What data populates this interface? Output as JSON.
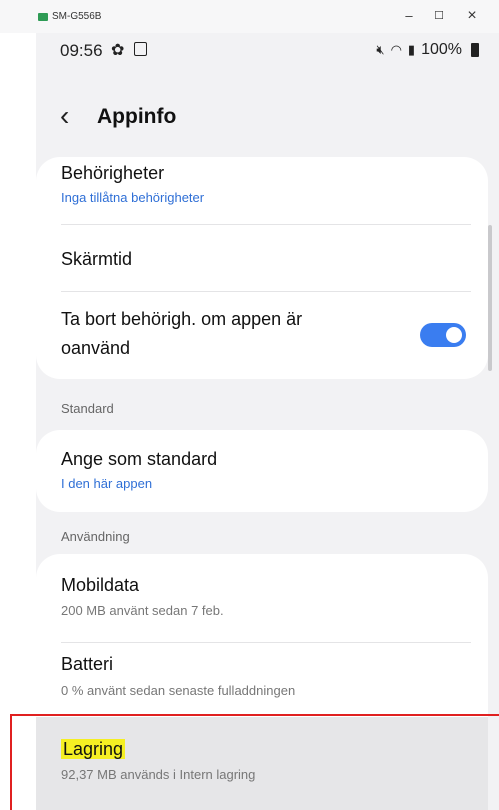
{
  "window": {
    "title": "SM-G556B",
    "minimize": "–",
    "maximize": "☐",
    "close": "×"
  },
  "status_bar": {
    "time": "09:56",
    "battery": "100%"
  },
  "app_bar": {
    "title": "Appinfo"
  },
  "items": {
    "permissions": {
      "title": "Behörigheter",
      "subtitle": "Inga tillåtna behörigheter"
    },
    "screen_time": {
      "title": "Skärmtid"
    },
    "remove_perms": {
      "title_line1": "Ta bort behörigh. om appen är",
      "title_line2": "oanvänd",
      "toggle_on": true
    },
    "set_default": {
      "title": "Ange som standard",
      "subtitle": "I den här appen"
    },
    "mobile_data": {
      "title": "Mobildata",
      "subtitle": "200 MB använt sedan 7 feb."
    },
    "battery": {
      "title": "Batteri",
      "subtitle": "0 % använt sedan senaste fulladdningen"
    },
    "storage": {
      "title": "Lagring",
      "subtitle": "92,37 MB används i Intern lagring"
    }
  },
  "sections": {
    "standard": "Standard",
    "usage": "Användning"
  },
  "colors": {
    "accent": "#3a7df0",
    "link_blue": "#2f6fd6",
    "annotation_red": "#e02020",
    "annotation_yellow": "#f5ef23"
  }
}
